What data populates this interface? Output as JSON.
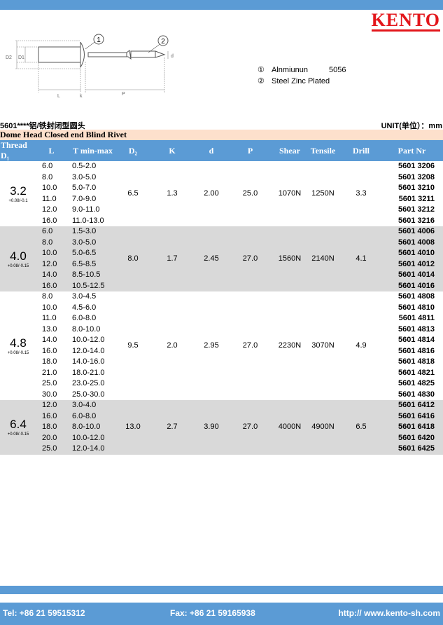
{
  "brand": "KENTO",
  "legend": [
    {
      "num": "①",
      "material": "Alnmiunun",
      "grade": "5056"
    },
    {
      "num": "②",
      "material": "Steel Zinc Plated",
      "grade": ""
    }
  ],
  "drawing_labels": {
    "callout1": "1",
    "callout2": "2",
    "d2": "D2",
    "d1": "D1",
    "d": "d",
    "l": "L",
    "k": "k",
    "p": "P"
  },
  "title": "5601****铝/铁封闭型圆头",
  "unit": "UNIT(单位）：mm",
  "subtitle": "Dome Head Closed end Blind Rivet",
  "headers": {
    "thread": "Thread D₁",
    "l": "L",
    "t": "T min-max",
    "d2": "D₂",
    "k": "K",
    "d": "d",
    "p": "P",
    "shear": "Shear",
    "tensile": "Tensile",
    "drill": "Drill",
    "part": "Part Nr"
  },
  "groups": [
    {
      "thread": "3.2",
      "tol": "+0.08/-0.1",
      "d2": "6.5",
      "k": "1.3",
      "d": "2.00",
      "p": "25.0",
      "shear": "1070N",
      "tensile": "1250N",
      "drill": "3.3",
      "grey": false,
      "rows": [
        {
          "l": "6.0",
          "t": "0.5-2.0",
          "part": "5601 3206"
        },
        {
          "l": "8.0",
          "t": "3.0-5.0",
          "part": "5601 3208"
        },
        {
          "l": "10.0",
          "t": "5.0-7.0",
          "part": "5601 3210"
        },
        {
          "l": "11.0",
          "t": "7.0-9.0",
          "part": "5601 3211"
        },
        {
          "l": "12.0",
          "t": "9.0-11.0",
          "part": "5601 3212"
        },
        {
          "l": "16.0",
          "t": "11.0-13.0",
          "part": "5601 3216"
        }
      ]
    },
    {
      "thread": "4.0",
      "tol": "+0.08/-0.15",
      "d2": "8.0",
      "k": "1.7",
      "d": "2.45",
      "p": "27.0",
      "shear": "1560N",
      "tensile": "2140N",
      "drill": "4.1",
      "grey": true,
      "rows": [
        {
          "l": "6.0",
          "t": "1.5-3.0",
          "part": "5601 4006"
        },
        {
          "l": "8.0",
          "t": "3.0-5.0",
          "part": "5601 4008"
        },
        {
          "l": "10.0",
          "t": "5.0-6.5",
          "part": "5601 4010"
        },
        {
          "l": "12.0",
          "t": "6.5-8.5",
          "part": "5601 4012"
        },
        {
          "l": "14.0",
          "t": "8.5-10.5",
          "part": "5601 4014"
        },
        {
          "l": "16.0",
          "t": "10.5-12.5",
          "part": "5601 4016"
        }
      ]
    },
    {
      "thread": "4.8",
      "tol": "+0.08/-0.15",
      "d2": "9.5",
      "k": "2.0",
      "d": "2.95",
      "p": "27.0",
      "shear": "2230N",
      "tensile": "3070N",
      "drill": "4.9",
      "grey": false,
      "rows": [
        {
          "l": "8.0",
          "t": "3.0-4.5",
          "part": "5601 4808"
        },
        {
          "l": "10.0",
          "t": "4.5-6.0",
          "part": "5601 4810"
        },
        {
          "l": "11.0",
          "t": "6.0-8.0",
          "part": "5601 4811"
        },
        {
          "l": "13.0",
          "t": "8.0-10.0",
          "part": "5601 4813"
        },
        {
          "l": "14.0",
          "t": "10.0-12.0",
          "part": "5601 4814"
        },
        {
          "l": "16.0",
          "t": "12.0-14.0",
          "part": "5601 4816"
        },
        {
          "l": "18.0",
          "t": "14.0-16.0",
          "part": "5601 4818"
        },
        {
          "l": "21.0",
          "t": "18.0-21.0",
          "part": "5601 4821"
        },
        {
          "l": "25.0",
          "t": "23.0-25.0",
          "part": "5601 4825"
        },
        {
          "l": "30.0",
          "t": "25.0-30.0",
          "part": "5601 4830"
        }
      ]
    },
    {
      "thread": "6.4",
      "tol": "+0.08/-0.15",
      "d2": "13.0",
      "k": "2.7",
      "d": "3.90",
      "p": "27.0",
      "shear": "4000N",
      "tensile": "4900N",
      "drill": "6.5",
      "grey": true,
      "rows": [
        {
          "l": "12.0",
          "t": "3.0-4.0",
          "part": "5601 6412"
        },
        {
          "l": "16.0",
          "t": "6.0-8.0",
          "part": "5601 6416"
        },
        {
          "l": "18.0",
          "t": "8.0-10.0",
          "part": "5601 6418"
        },
        {
          "l": "20.0",
          "t": "10.0-12.0",
          "part": "5601 6420"
        },
        {
          "l": "25.0",
          "t": "12.0-14.0",
          "part": "5601 6425"
        }
      ]
    }
  ],
  "footer": {
    "tel": "Tel: +86 21 59515312",
    "fax": "Fax: +86 21 59165938",
    "web": "http:// www.kento-sh.com"
  }
}
